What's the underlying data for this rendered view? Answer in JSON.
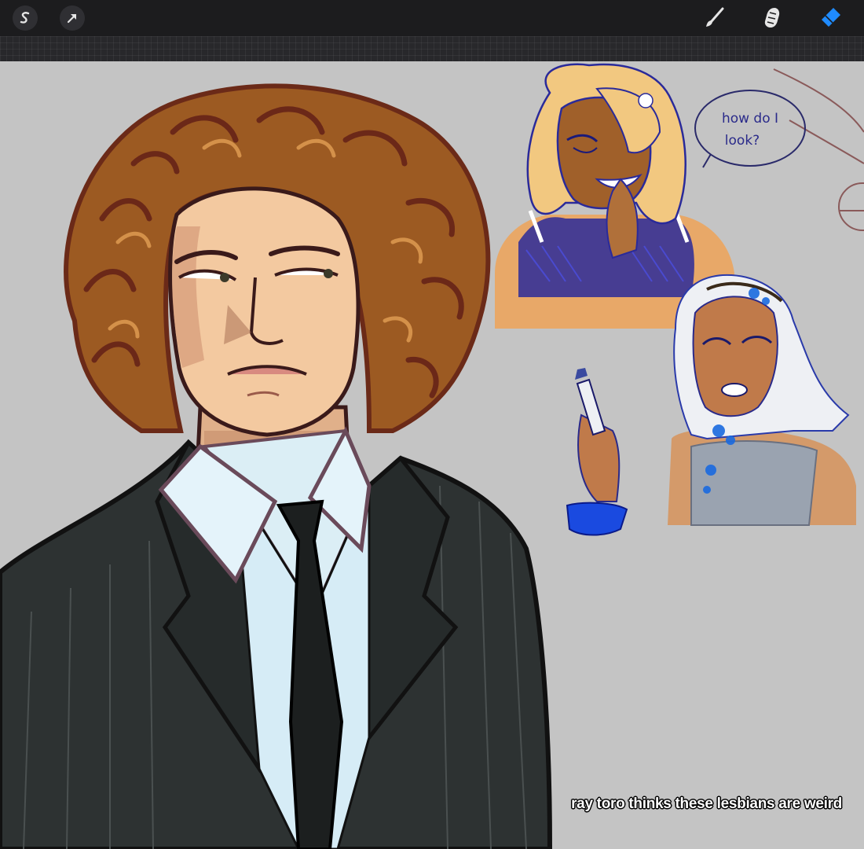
{
  "toolbar": {
    "left_tools": [
      {
        "name": "modify-tool",
        "glyph": "S"
      },
      {
        "name": "transform-tool",
        "glyph": "arrow"
      }
    ],
    "right_tools": [
      {
        "name": "brush-tool",
        "icon": "brush-icon",
        "active": false
      },
      {
        "name": "smudge-tool",
        "icon": "smudge-icon",
        "active": false
      },
      {
        "name": "eraser-tool",
        "icon": "eraser-icon",
        "active": true
      }
    ],
    "colors": {
      "bar": "#1c1c1e",
      "icon": "#e6e6e6",
      "active": "#1f8bff"
    }
  },
  "canvas": {
    "background": "#c4c4c4",
    "speech_bubble_text": [
      "how do I",
      "look?"
    ],
    "caption": "ray toro thinks these lesbians are weird"
  }
}
